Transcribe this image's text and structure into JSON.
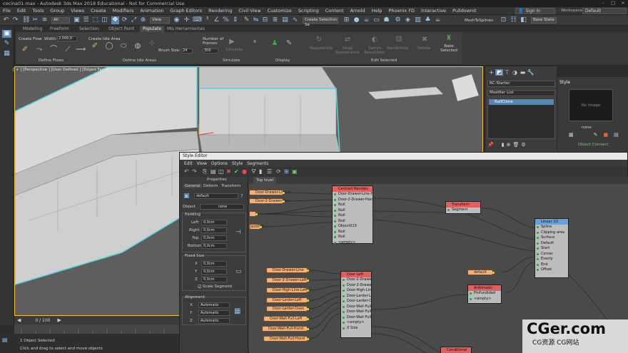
{
  "titlebar": {
    "title": "cocina01.max - Autodesk 3ds Max 2018 Educational - Not for Commercial Use"
  },
  "menubar": {
    "items": [
      "File",
      "Edit",
      "Tools",
      "Group",
      "Views",
      "Create",
      "Modifiers",
      "Animation",
      "Graph Editors",
      "Rendering",
      "Civil View",
      "Customize",
      "Scripting",
      "Content",
      "Arnold",
      "Help",
      "Phoenix FD",
      "Interactive",
      "Pulldownit"
    ],
    "signin": "Sign In",
    "workspaces_label": "Workspaces:",
    "workspace": "Default"
  },
  "toolbar": {
    "filter": "All",
    "view": "View",
    "selection_set": "Create Selection Se",
    "mesh_tool": "MeshToSplines",
    "base_state": "Base State"
  },
  "ribbon": {
    "tabs": [
      "Modeling",
      "Freeform",
      "Selection",
      "Object Paint",
      "Populate",
      "Mis Herramientas"
    ],
    "active_tab": "Populate",
    "create_flow": "Create Flow",
    "width_label": "Width:",
    "width_value": "2,000,0",
    "define_flows": "Define Flows",
    "create_idle": "Create Idle Area",
    "brush_size_label": "Brush Size:",
    "brush_size": "24",
    "define_idle": "Define Idle Areas",
    "frames_label": "Number of Frames:",
    "frames_value": "300",
    "simulate_btn": "Simulate",
    "simulate_group": "Simulate",
    "display_group": "Display",
    "regenerate": "Regenerate",
    "swap": "Swap Appearance",
    "switch_res": "Switch Resolution",
    "randomize": "Randomize",
    "delete": "Delete",
    "bake": "Bake Selected",
    "edit_selected": "Edit Selected"
  },
  "viewport": {
    "label": "[ + ] [Perspective ] [User Defined ] [Edged Faces ]"
  },
  "command_panel": {
    "object_name": "RC-Starter",
    "modifier_list": "Modifier List",
    "stack_item": "RailClone",
    "style_title": "Style",
    "no_image": "No Image",
    "none": "none",
    "object_connect": "Object Connect"
  },
  "editor": {
    "title": "Style Editor",
    "menu": [
      "Edit",
      "View",
      "Options",
      "Style",
      "Segments"
    ],
    "top_level": "Top level",
    "props_title": "Properties",
    "props_tabs": [
      "General",
      "Deform",
      "Transform"
    ],
    "name": "default",
    "object_label": "Object",
    "object_value": "none",
    "padding_label": "Padding",
    "left": "Left",
    "right": "Right",
    "top": "Top",
    "bottom": "Bottom",
    "zero": "0,0cm",
    "fixed_size": "Fixed Size",
    "x": "X",
    "y": "Y",
    "z": "Z",
    "scale_segment": "Scale Segment",
    "alignment": "Alignment",
    "automatic": "Automatic"
  },
  "nodes": {
    "centred": {
      "title": "Centred Handles",
      "rows": [
        "Door-Drawer-Line-Har",
        "Door-2-Drawer-Handl",
        "Null",
        "Null",
        "Null",
        "Null",
        "Object013",
        "Null",
        "Null",
        "<empty>"
      ]
    },
    "transform": {
      "title": "Transform",
      "rows": [
        "Segment"
      ]
    },
    "linear": {
      "title": "Linear 1D",
      "rows": [
        "Spline",
        "Clipping area",
        "Surface",
        "Default",
        "Start",
        "Corner",
        "Evenly",
        "End",
        "Offset"
      ]
    },
    "doorleft": {
      "title": "Door Left",
      "rows": [
        "Door-2-Drawer-Le",
        "Door-2-Drawer-Li",
        "Door-High-Line-",
        "Door-Larder-Lef",
        "Door-Larder-Ov",
        "Door-Wall-Full-L",
        "Door-Wall-Full-",
        "Door-Wall-Full-",
        "<empty>",
        "X Size"
      ]
    },
    "arith": {
      "title": "Arithmetic",
      "rows": [
        "Profundidad",
        "<empty>"
      ]
    },
    "conditional": {
      "title": "Conditional"
    },
    "pills_top": [
      "Door-Drawer-Line-H",
      "Door-2-Drawer-Har",
      "",
      "ject013"
    ],
    "pills_left": [
      "Door-Drawer-Line",
      "Door-2-Drawer-Left",
      "Door-High-Line-Left",
      "Door-Larder-Left",
      "Door-Larder-Oven",
      "Door-Wall-Full-Left",
      "Door-Wall-Full-Hand",
      "Door-Wall-Full-Hand"
    ],
    "default_pill": "default"
  },
  "timeline": {
    "frame": "0 / 100"
  },
  "status": {
    "selected": "1 Object Selected",
    "hint": "Click and drag to select and move objects"
  },
  "watermark": {
    "brand": "CGer.com",
    "sub": "CG资源 CG网站"
  }
}
